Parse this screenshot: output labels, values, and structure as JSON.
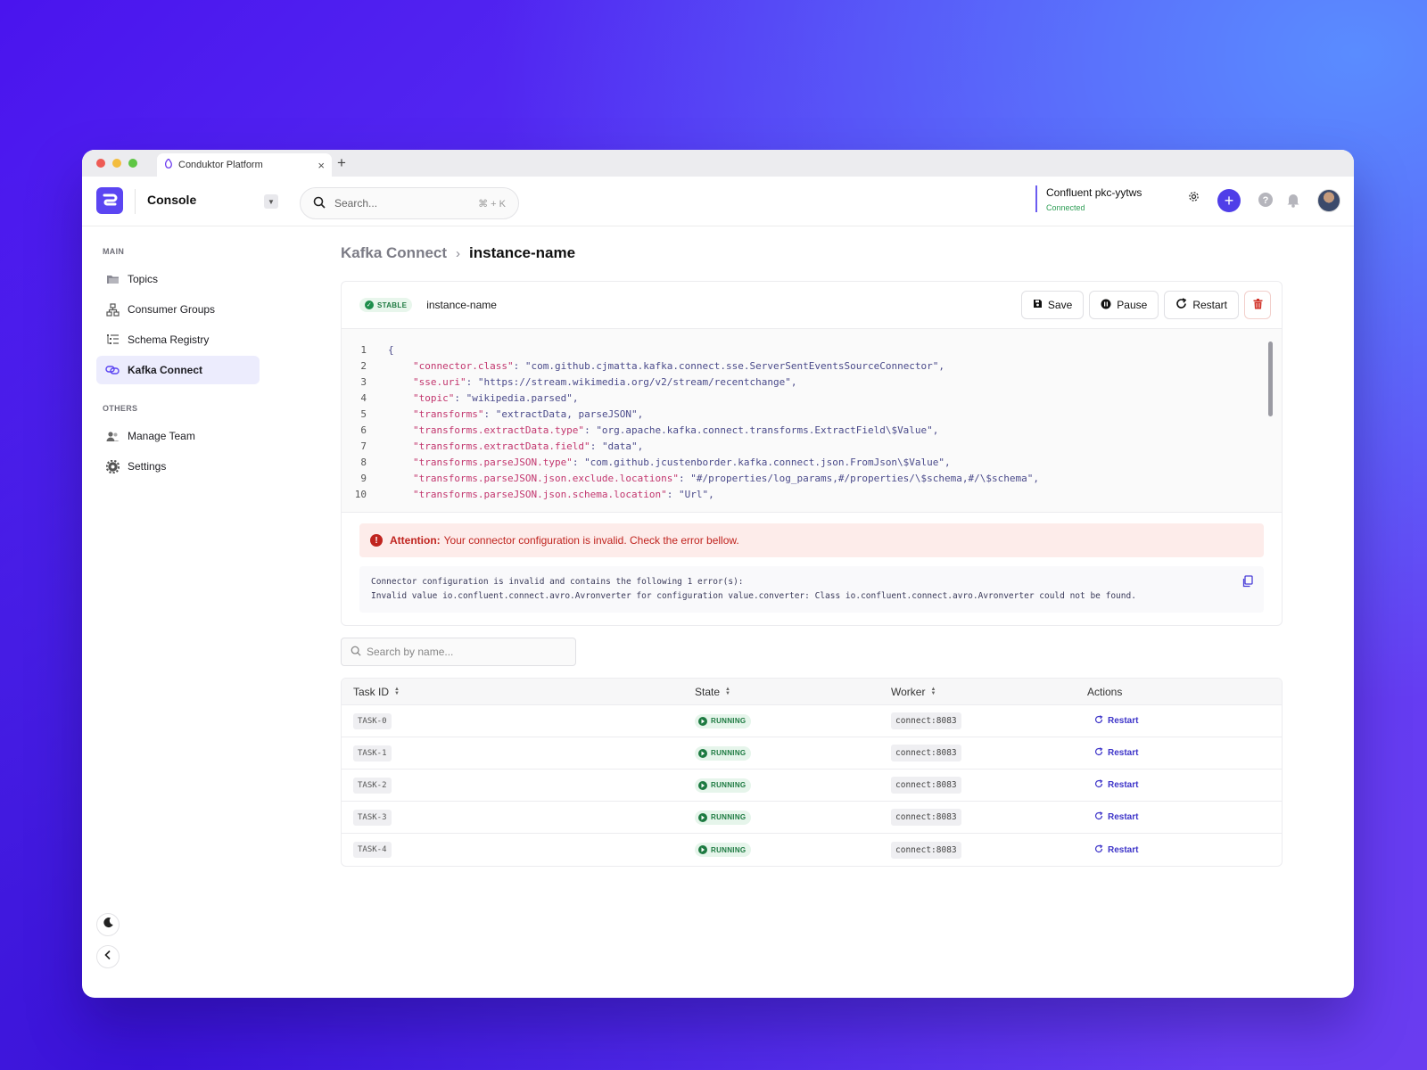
{
  "browser": {
    "tab_title": "Conduktor Platform",
    "tab_close": "×",
    "new_tab": "+"
  },
  "header": {
    "app_title": "Console",
    "search_placeholder": "Search...",
    "search_shortcut": "⌘ + K",
    "cluster_name": "Confluent pkc-yytws",
    "cluster_status": "Connected",
    "icons": [
      "settings-icon",
      "plus-icon",
      "help-icon",
      "bell-icon",
      "avatar"
    ],
    "accent": "#4f3ee8"
  },
  "sidebar": {
    "main_label": "MAIN",
    "main_items": [
      {
        "label": "Topics",
        "icon": "folder-icon",
        "active": false
      },
      {
        "label": "Consumer Groups",
        "icon": "groups-icon",
        "active": false
      },
      {
        "label": "Schema Registry",
        "icon": "schema-icon",
        "active": false
      },
      {
        "label": "Kafka Connect",
        "icon": "connect-icon",
        "active": true
      }
    ],
    "others_label": "OTHERS",
    "other_items": [
      {
        "label": "Manage Team",
        "icon": "team-icon"
      },
      {
        "label": "Settings",
        "icon": "gear-icon"
      }
    ]
  },
  "breadcrumb": {
    "parent": "Kafka Connect",
    "separator": "›",
    "current": "instance-name"
  },
  "connector": {
    "badge": "STABLE",
    "name": "instance-name",
    "actions": {
      "save": "Save",
      "pause": "Pause",
      "restart": "Restart"
    },
    "code_lines": [
      {
        "n": "1",
        "key": "",
        "sep": "",
        "val": "{",
        "indent": false
      },
      {
        "n": "2",
        "key": "\"connector.class\"",
        "sep": ": ",
        "val": "\"com.github.cjmatta.kafka.connect.sse.ServerSentEventsSourceConnector\",",
        "indent": true
      },
      {
        "n": "3",
        "key": "\"sse.uri\"",
        "sep": ": ",
        "val": "\"https://stream.wikimedia.org/v2/stream/recentchange\",",
        "indent": true
      },
      {
        "n": "4",
        "key": "\"topic\"",
        "sep": ": ",
        "val": "\"wikipedia.parsed\",",
        "indent": true
      },
      {
        "n": "5",
        "key": "\"transforms\"",
        "sep": ": ",
        "val": "\"extractData, parseJSON\",",
        "indent": true
      },
      {
        "n": "6",
        "key": "\"transforms.extractData.type\"",
        "sep": ": ",
        "val": "\"org.apache.kafka.connect.transforms.ExtractField\\$Value\",",
        "indent": true
      },
      {
        "n": "7",
        "key": "\"transforms.extractData.field\"",
        "sep": ": ",
        "val": "\"data\",",
        "indent": true
      },
      {
        "n": "8",
        "key": "\"transforms.parseJSON.type\"",
        "sep": ": ",
        "val": "\"com.github.jcustenborder.kafka.connect.json.FromJson\\$Value\",",
        "indent": true
      },
      {
        "n": "9",
        "key": "\"transforms.parseJSON.json.exclude.locations\"",
        "sep": ": ",
        "val": "\"#/properties/log_params,#/properties/\\$schema,#/\\$schema\",",
        "indent": true
      },
      {
        "n": "10",
        "key": "\"transforms.parseJSON.json.schema.location\"",
        "sep": ": ",
        "val": "\"Url\",",
        "indent": true
      }
    ],
    "alert_title": "Attention:",
    "alert_text": "Your connector configuration is invalid. Check the error bellow.",
    "error_line_1": "Connector configuration is invalid and contains the following 1 error(s):",
    "error_line_2": "Invalid value io.confluent.connect.avro.Avronverter for configuration value.converter: Class io.confluent.connect.avro.Avronverter could not be found."
  },
  "tasks": {
    "search_placeholder": "Search by name...",
    "columns": [
      "Task ID",
      "State",
      "Worker",
      "Actions"
    ],
    "rows": [
      {
        "id": "TASK-0",
        "state": "RUNNING",
        "worker": "connect:8083",
        "action": "Restart"
      },
      {
        "id": "TASK-1",
        "state": "RUNNING",
        "worker": "connect:8083",
        "action": "Restart"
      },
      {
        "id": "TASK-2",
        "state": "RUNNING",
        "worker": "connect:8083",
        "action": "Restart"
      },
      {
        "id": "TASK-3",
        "state": "RUNNING",
        "worker": "connect:8083",
        "action": "Restart"
      },
      {
        "id": "TASK-4",
        "state": "RUNNING",
        "worker": "connect:8083",
        "action": "Restart"
      }
    ]
  }
}
